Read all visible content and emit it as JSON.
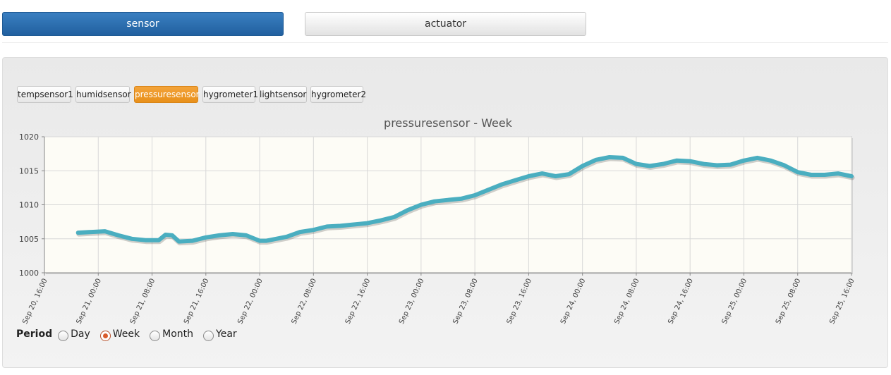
{
  "tabs": [
    {
      "label": "sensor",
      "active": true
    },
    {
      "label": "actuator",
      "active": false
    }
  ],
  "sensors": [
    {
      "label": "tempsensor1",
      "active": false
    },
    {
      "label": "humidsensor",
      "active": false
    },
    {
      "label": "pressuresensor",
      "active": true
    },
    {
      "label": "hygrometer1",
      "active": false
    },
    {
      "label": "lightsensor",
      "active": false
    },
    {
      "label": "hygrometer2",
      "active": false
    }
  ],
  "period": {
    "label": "Period",
    "options": [
      "Day",
      "Week",
      "Month",
      "Year"
    ],
    "selected": "Week"
  },
  "colors": {
    "line": "#4aaec0",
    "plot_bg": "#fdfcf6",
    "active_tab": "#2a6aa9",
    "active_sensor": "#ec9a28"
  },
  "chart_data": {
    "type": "line",
    "title": "pressuresensor - Week",
    "xlabel": "",
    "ylabel": "",
    "ylim": [
      1000,
      1020
    ],
    "yticks": [
      "1020",
      "1015",
      "1010",
      "1005",
      "1000"
    ],
    "xticks": [
      "Sep 20, 16:00",
      "Sep 21, 00:00",
      "Sep 21, 08:00",
      "Sep 21, 16:00",
      "Sep 22, 00:00",
      "Sep 22, 08:00",
      "Sep 22, 16:00",
      "Sep 23, 00:00",
      "Sep 23, 08:00",
      "Sep 23, 16:00",
      "Sep 24, 00:00",
      "Sep 24, 08:00",
      "Sep 24, 16:00",
      "Sep 25, 00:00",
      "Sep 25, 08:00",
      "Sep 25, 16:00"
    ],
    "xlim": [
      0,
      120
    ],
    "grid": true,
    "series": [
      {
        "x": [
          5,
          7,
          9,
          11,
          13,
          15,
          17,
          18,
          19,
          20,
          22,
          24,
          26,
          28,
          30,
          32,
          33,
          34,
          36,
          38,
          40,
          42,
          44,
          46,
          48,
          50,
          52,
          54,
          56,
          58,
          60,
          62,
          64,
          66,
          68,
          70,
          72,
          74,
          76,
          78,
          80,
          82,
          84,
          86,
          88,
          90,
          92,
          94,
          96,
          98,
          100,
          102,
          104,
          106,
          108,
          110,
          112,
          114,
          116,
          118,
          120
        ],
        "values": [
          1005.9,
          1006.0,
          1006.1,
          1005.5,
          1005.0,
          1004.8,
          1004.8,
          1005.6,
          1005.5,
          1004.6,
          1004.7,
          1005.2,
          1005.5,
          1005.7,
          1005.5,
          1004.7,
          1004.7,
          1004.9,
          1005.3,
          1006.0,
          1006.3,
          1006.8,
          1006.9,
          1007.1,
          1007.3,
          1007.7,
          1008.2,
          1009.2,
          1010.0,
          1010.5,
          1010.7,
          1010.9,
          1011.4,
          1012.2,
          1013.0,
          1013.6,
          1014.2,
          1014.6,
          1014.2,
          1014.5,
          1015.7,
          1016.6,
          1017.0,
          1016.9,
          1016.0,
          1015.7,
          1016.0,
          1016.5,
          1016.4,
          1016.0,
          1015.8,
          1015.9,
          1016.5,
          1016.9,
          1016.5,
          1015.8,
          1014.8,
          1014.4,
          1014.4,
          1014.6,
          1014.2
        ]
      }
    ]
  }
}
